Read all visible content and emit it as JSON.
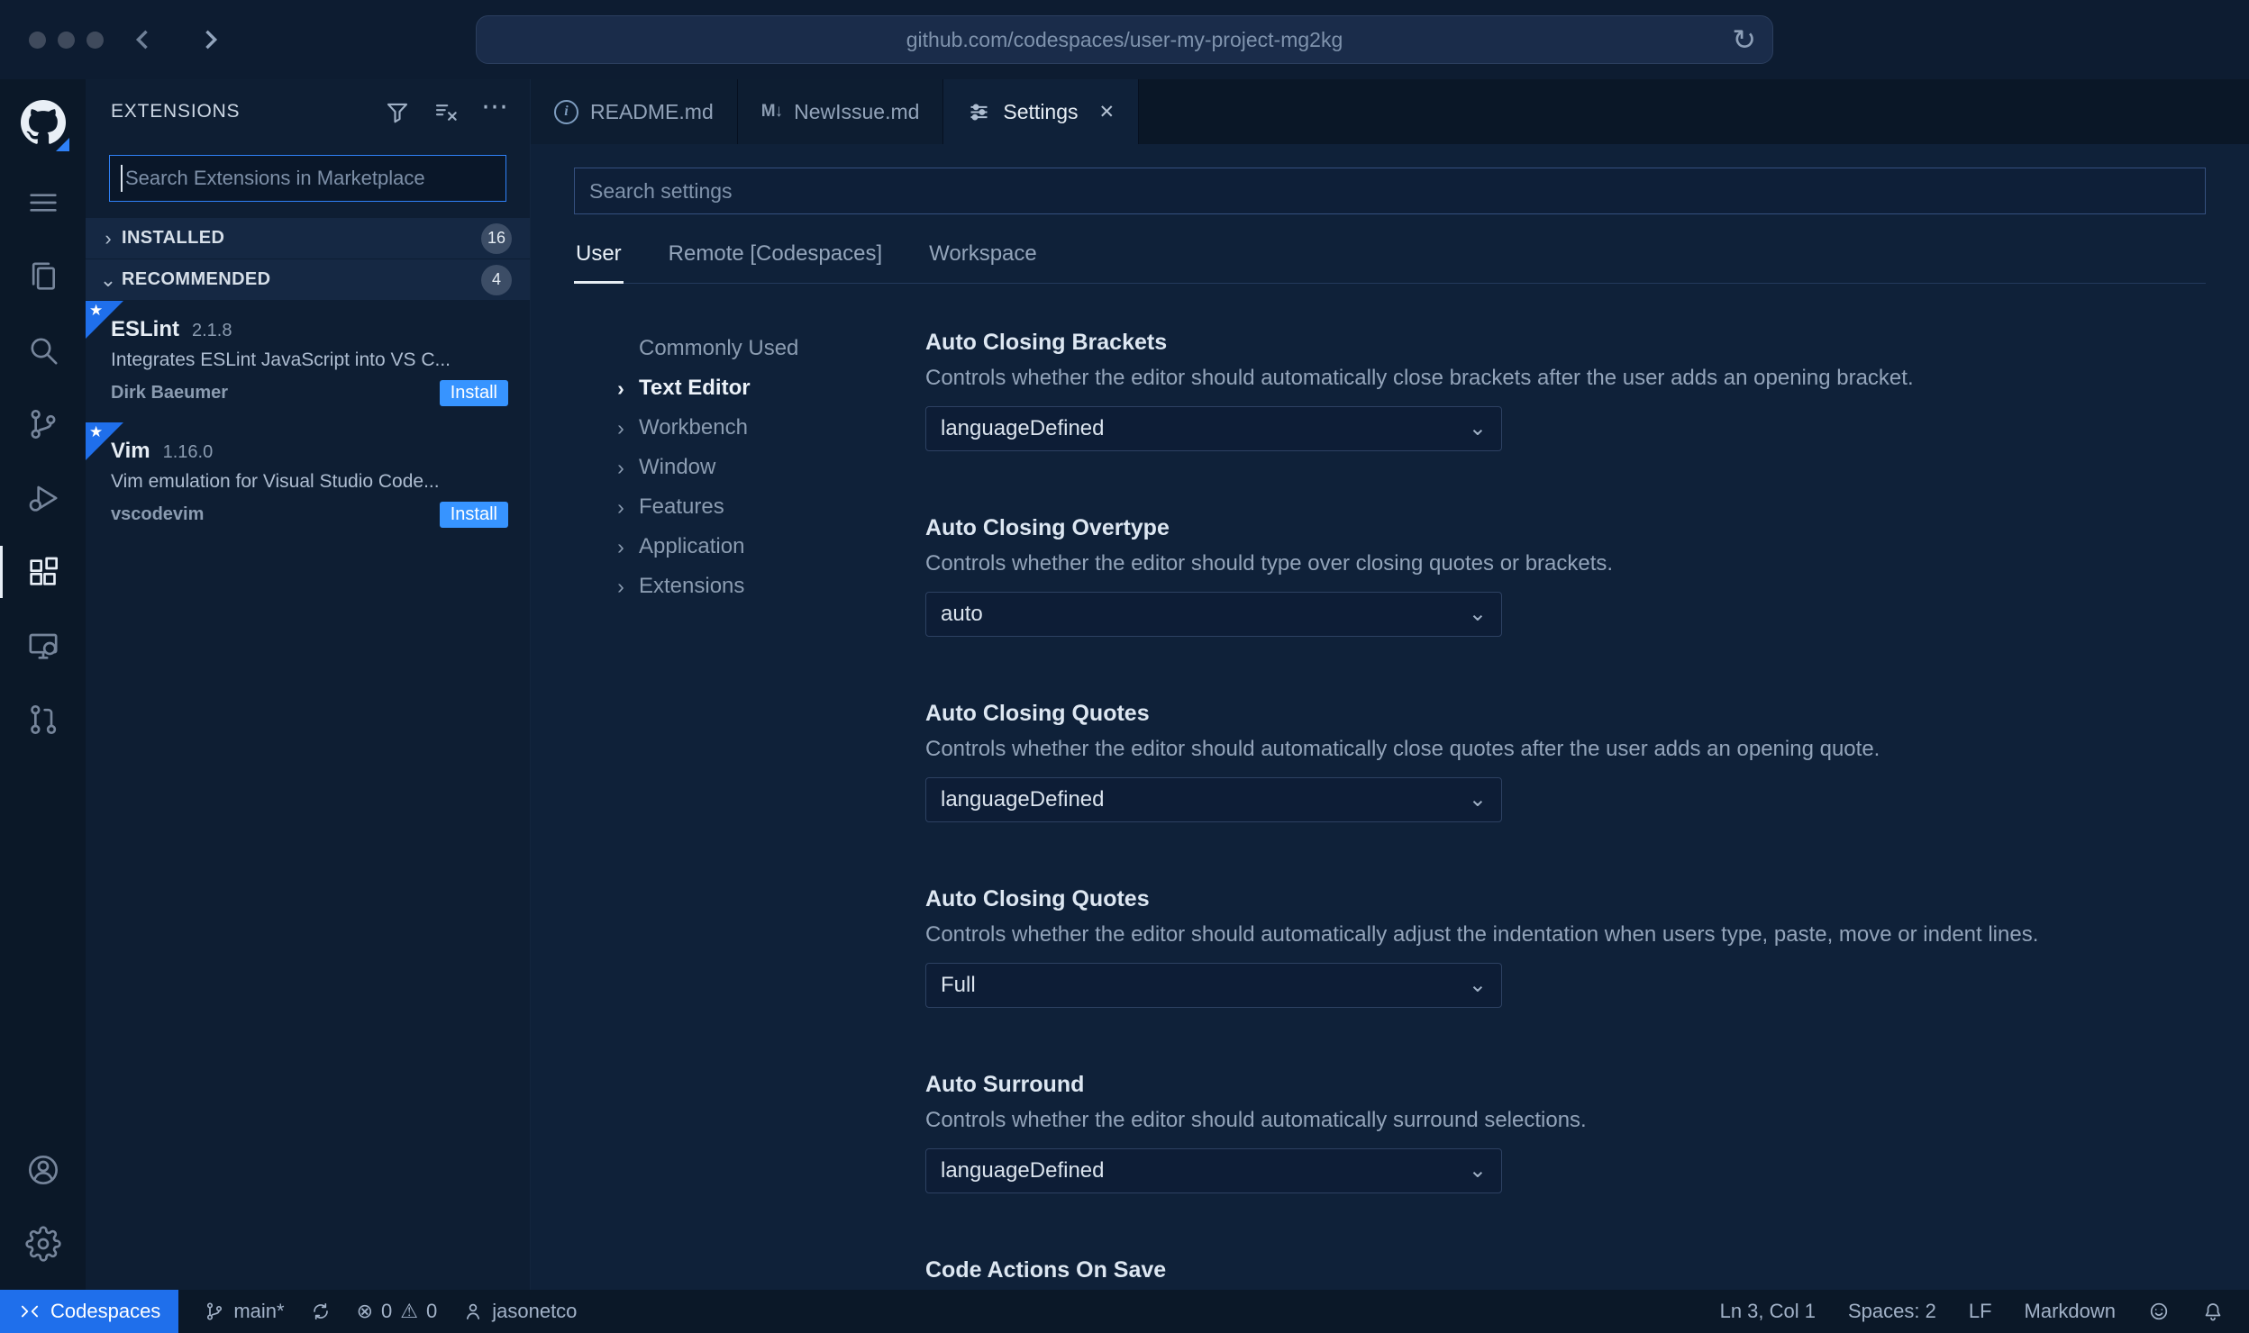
{
  "browser": {
    "url": "github.com/codespaces/user-my-project-mg2kg"
  },
  "icons": {
    "refresh": "↻",
    "chevron_right": "›",
    "chevron_down": "⌄",
    "close": "✕",
    "more": "⋯",
    "star": "★",
    "info": "i",
    "markdown": "M↓",
    "error": "⊗",
    "warning": "⚠"
  },
  "sidebar": {
    "title": "EXTENSIONS",
    "search_placeholder": "Search Extensions in Marketplace",
    "sections": [
      {
        "label": "INSTALLED",
        "badge": "16"
      },
      {
        "label": "RECOMMENDED",
        "badge": "4"
      }
    ],
    "extensions": [
      {
        "name": "ESLint",
        "version": "2.1.8",
        "description": "Integrates ESLint JavaScript into VS C...",
        "publisher": "Dirk Baeumer",
        "action_label": "Install"
      },
      {
        "name": "Vim",
        "version": "1.16.0",
        "description": "Vim emulation for Visual Studio Code...",
        "publisher": "vscodevim",
        "action_label": "Install"
      }
    ]
  },
  "editor_tabs": [
    {
      "label": "README.md"
    },
    {
      "label": "NewIssue.md"
    },
    {
      "label": "Settings"
    }
  ],
  "settings": {
    "search_placeholder": "Search settings",
    "scopes": [
      {
        "label": "User"
      },
      {
        "label": "Remote [Codespaces]"
      },
      {
        "label": "Workspace"
      }
    ],
    "toc": [
      {
        "label": "Commonly Used"
      },
      {
        "label": "Text Editor"
      },
      {
        "label": "Workbench"
      },
      {
        "label": "Window"
      },
      {
        "label": "Features"
      },
      {
        "label": "Application"
      },
      {
        "label": "Extensions"
      }
    ],
    "items": [
      {
        "title": "Auto Closing Brackets",
        "description": "Controls whether the editor should automatically close brackets after the user adds an opening bracket.",
        "value": "languageDefined"
      },
      {
        "title": "Auto Closing Overtype",
        "description": "Controls whether the editor should type over closing quotes or brackets.",
        "value": "auto"
      },
      {
        "title": "Auto Closing Quotes",
        "description": "Controls whether the editor should automatically close quotes after the user adds an opening quote.",
        "value": "languageDefined"
      },
      {
        "title": "Auto Closing Quotes",
        "description": "Controls whether the editor should automatically adjust the indentation when users type, paste, move or indent lines.",
        "value": "Full"
      },
      {
        "title": "Auto Surround",
        "description": "Controls whether the editor should automatically surround selections.",
        "value": "languageDefined"
      },
      {
        "title": "Code Actions On Save",
        "description": "",
        "value": ""
      }
    ]
  },
  "status_bar": {
    "codespaces_label": "Codespaces",
    "branch": "main*",
    "errors": "0",
    "warnings": "0",
    "user": "jasonetco",
    "cursor": "Ln 3, Col 1",
    "indent": "Spaces: 2",
    "eol": "LF",
    "language": "Markdown"
  }
}
